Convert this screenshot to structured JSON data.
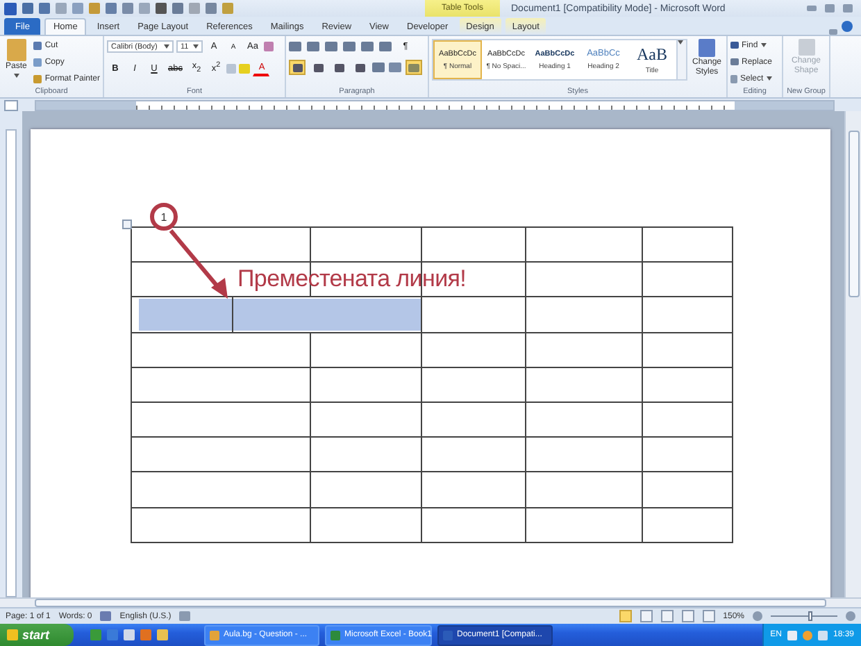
{
  "window": {
    "title": "Document1 [Compatibility Mode] - Microsoft Word",
    "contextual_group": "Table Tools"
  },
  "tabs": [
    {
      "label": "File",
      "kind": "file",
      "selected": false
    },
    {
      "label": "Home",
      "kind": "normal",
      "selected": true
    },
    {
      "label": "Insert",
      "kind": "normal",
      "selected": false
    },
    {
      "label": "Page Layout",
      "kind": "normal",
      "selected": false
    },
    {
      "label": "References",
      "kind": "normal",
      "selected": false
    },
    {
      "label": "Mailings",
      "kind": "normal",
      "selected": false
    },
    {
      "label": "Review",
      "kind": "normal",
      "selected": false
    },
    {
      "label": "View",
      "kind": "normal",
      "selected": false
    },
    {
      "label": "Developer",
      "kind": "normal",
      "selected": false
    },
    {
      "label": "Design",
      "kind": "contextual",
      "selected": false
    },
    {
      "label": "Layout",
      "kind": "contextual",
      "selected": false
    }
  ],
  "ribbon": {
    "clipboard": {
      "label": "Clipboard",
      "paste": "Paste",
      "cut": "Cut",
      "copy": "Copy",
      "format_painter": "Format Painter"
    },
    "font": {
      "label": "Font",
      "font_name": "Calibri (Body)",
      "font_size": "11",
      "grow": "A",
      "shrink": "A",
      "change_case": "Aa",
      "bold": "B",
      "italic": "I",
      "underline": "U",
      "strikethrough": "abc",
      "subscript": "x$_{2}$",
      "superscript": "x$^{2}$",
      "font_color": "A"
    },
    "paragraph": {
      "label": "Paragraph",
      "show_marks": "¶",
      "alignments": [
        {
          "selected": true
        },
        {
          "selected": false
        },
        {
          "selected": false
        },
        {
          "selected": false
        }
      ],
      "borders": {
        "selected": true
      }
    },
    "styles": {
      "label": "Styles",
      "items": [
        {
          "preview": "AaBbCcDc",
          "name": "¶ Normal",
          "kind": "normal",
          "selected": true
        },
        {
          "preview": "AaBbCcDc",
          "name": "¶ No Spaci...",
          "kind": "normal",
          "selected": false
        },
        {
          "preview": "AaBbCcDc",
          "name": "Heading 1",
          "kind": "heading1",
          "selected": false
        },
        {
          "preview": "AaBbCc",
          "name": "Heading 2",
          "kind": "heading2",
          "selected": false
        },
        {
          "preview": "AaB",
          "name": "Title",
          "kind": "title",
          "selected": false
        }
      ],
      "change_styles": "Change Styles"
    },
    "editing": {
      "label": "Editing",
      "find": "Find",
      "replace": "Replace",
      "select": "Select"
    },
    "new_group": {
      "label": "New Group",
      "change_shape": "Change Shape",
      "disabled": true
    }
  },
  "document": {
    "table": {
      "rows": [
        {
          "kind": "standard",
          "cells": [
            {
              "selected": false
            },
            {
              "selected": false
            },
            {
              "selected": false
            },
            {
              "selected": false
            },
            {
              "selected": false
            }
          ]
        },
        {
          "kind": "standard",
          "cells": [
            {
              "selected": false
            },
            {
              "selected": false
            },
            {
              "selected": false
            },
            {
              "selected": false
            },
            {
              "selected": false
            }
          ]
        },
        {
          "kind": "moved_border",
          "cells": [
            {
              "selected": true
            },
            {
              "selected": true
            },
            {
              "selected": false
            },
            {
              "selected": false
            },
            {
              "selected": false
            }
          ]
        },
        {
          "kind": "standard",
          "cells": [
            {
              "selected": false
            },
            {
              "selected": false
            },
            {
              "selected": false
            },
            {
              "selected": false
            },
            {
              "selected": false
            }
          ]
        },
        {
          "kind": "standard",
          "cells": [
            {
              "selected": false
            },
            {
              "selected": false
            },
            {
              "selected": false
            },
            {
              "selected": false
            },
            {
              "selected": false
            }
          ]
        },
        {
          "kind": "standard",
          "cells": [
            {
              "selected": false
            },
            {
              "selected": false
            },
            {
              "selected": false
            },
            {
              "selected": false
            },
            {
              "selected": false
            }
          ]
        },
        {
          "kind": "standard",
          "cells": [
            {
              "selected": false
            },
            {
              "selected": false
            },
            {
              "selected": false
            },
            {
              "selected": false
            },
            {
              "selected": false
            }
          ]
        },
        {
          "kind": "standard",
          "cells": [
            {
              "selected": false
            },
            {
              "selected": false
            },
            {
              "selected": false
            },
            {
              "selected": false
            },
            {
              "selected": false
            }
          ]
        },
        {
          "kind": "standard",
          "cells": [
            {
              "selected": false
            },
            {
              "selected": false
            },
            {
              "selected": false
            },
            {
              "selected": false
            },
            {
              "selected": false
            }
          ]
        }
      ]
    },
    "annotation": {
      "number": "1",
      "text": "Преместената линия!"
    }
  },
  "status_bar": {
    "page": "Page: 1 of 1",
    "words": "Words: 0",
    "language": "English (U.S.)",
    "views": [
      {
        "selected": true
      },
      {
        "selected": false
      },
      {
        "selected": false
      },
      {
        "selected": false
      },
      {
        "selected": false
      }
    ],
    "zoom": "150%",
    "zoom_slider": {
      "level": 0.6
    }
  },
  "taskbar": {
    "start": "start",
    "tasks": [
      {
        "label": "Aula.bg - Question - ...",
        "kind": "browser",
        "selected": false
      },
      {
        "label": "Microsoft Excel - Book1",
        "kind": "excel",
        "selected": false
      },
      {
        "label": "Document1 [Compati...",
        "kind": "word",
        "selected": true
      }
    ],
    "language": "EN",
    "clock": "18:39"
  }
}
